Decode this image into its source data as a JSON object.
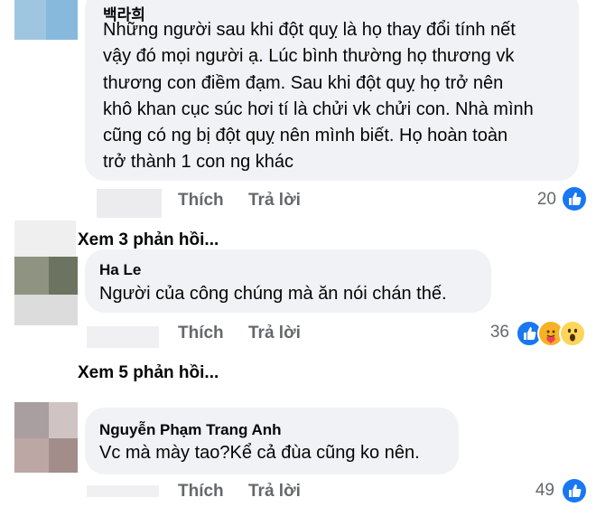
{
  "comments": [
    {
      "author": "백라희",
      "lines": [
        "Những người sau khi đột quỵ là họ thay đổi tính nết",
        "vậy đó mọi người ạ. Lúc bình thường họ thương vk",
        "thương con điềm đạm. Sau khi đột quỵ họ trở nên",
        "khô khan cục súc hơi tí là chửi vk chửi con. Nhà mình",
        "cũng có ng bị đột quỵ nên mình biết. Họ hoàn toàn",
        "trở thành 1 con ng khác"
      ],
      "like_label": "Thích",
      "reply_label": "Trả lời",
      "reaction_count": "20",
      "reactions": [
        "like-icon"
      ],
      "view_replies": "Xem 3 phản hồi..."
    },
    {
      "author": "Ha Le",
      "lines": [
        "Người của công chúng mà ăn nói chán thế."
      ],
      "like_label": "Thích",
      "reply_label": "Trả lời",
      "reaction_count": "36",
      "reactions": [
        "like-icon",
        "care-icon",
        "wow-icon"
      ],
      "view_replies": "Xem 5 phản hồi..."
    },
    {
      "author": "Nguyễn Phạm Trang Anh",
      "lines": [
        "Vc mà mày tao?Kể cả đùa cũng ko nên."
      ],
      "like_label": "Thích",
      "reply_label": "Trả lời",
      "reaction_count": "49",
      "reactions": [
        "like-icon"
      ]
    }
  ],
  "colors": {
    "bubble": "#f0f2f5",
    "like_blue": "#1877f2",
    "secondary_text": "#65676b",
    "care_yellow": "#f7b125",
    "wow_yellow": "#fcd55a"
  }
}
